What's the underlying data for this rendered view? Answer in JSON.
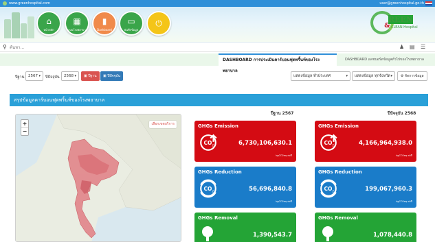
{
  "topbar": {
    "site": "www.greenhospital.com",
    "user": "user@greenhospital.go.th"
  },
  "nav": [
    {
      "icon": "home-icon",
      "glyph": "⌂",
      "label": "หน้าหลัก",
      "color": "#3aa54a"
    },
    {
      "icon": "hospital-icon",
      "glyph": "▦",
      "label": "ระบบโรงพยาบาล",
      "color": "#3aa54a"
    },
    {
      "icon": "chart-icon",
      "glyph": "▮",
      "label": "Dashboard",
      "color": "#f08a4b"
    },
    {
      "icon": "folder-icon",
      "glyph": "▭",
      "label": "บันทึกข้อมูล",
      "color": "#3aa54a"
    },
    {
      "icon": "power-icon",
      "glyph": "⏻",
      "label": "",
      "color": "#f4c518"
    }
  ],
  "logo": {
    "line1": "REEN",
    "amp": "&",
    "line2": "CLEAN Hospital"
  },
  "search": {
    "placeholder": "ค้นหา..."
  },
  "tabs": {
    "active": "DASHBOARD การประเมินคาร์บอนฟุตพริ้นท์ของโรงพยาบาล",
    "other": "DASHBOARD แดชบอร์ดข้อมูลทั่วไปของโรงพยาบาล"
  },
  "filters": {
    "base_label": "ปีฐาน",
    "base_value": "2567",
    "current_label": "ปีปัจจุบัน",
    "current_value": "2568",
    "base_btn": "ปีฐาน",
    "current_btn": "ปีปัจจุบัน",
    "scope_select": "แสดงข้อมูล ทั่วประเทศ",
    "type_select": "แสดงข้อมูล ทุกจังหวัด",
    "settings_btn": "จัดการข้อมูล"
  },
  "section": {
    "title": "สรุปข้อมูลคาร์บอนฟุตพริ้นท์ของโรงพยาบาล"
  },
  "map": {
    "link": "เลือกเขตบริการ"
  },
  "columns": {
    "base": "ปีฐาน 2567",
    "current": "ปีปัจจุบัน 2568"
  },
  "cards": {
    "base": [
      {
        "title": "GHGs Emission",
        "value": "6,730,106,630.1",
        "unit": "kgCO2eq ต่อปี",
        "kind": "emission"
      },
      {
        "title": "GHGs Reduction",
        "value": "56,696,840.8",
        "unit": "kgCO2eq ต่อปี",
        "kind": "reduction"
      },
      {
        "title": "GHGs Removal",
        "value": "1,390,543.7",
        "unit": "",
        "kind": "removal"
      }
    ],
    "current": [
      {
        "title": "GHGs Emission",
        "value": "4,166,964,938.0",
        "unit": "kgCO2eq ต่อปี",
        "kind": "emission"
      },
      {
        "title": "GHGs Reduction",
        "value": "199,067,960.3",
        "unit": "kgCO2eq ต่อปี",
        "kind": "reduction"
      },
      {
        "title": "GHGs Removal",
        "value": "1,078,440.8",
        "unit": "",
        "kind": "removal"
      }
    ]
  },
  "colors": {
    "emission": "#d40b13",
    "reduction": "#1a7cc9",
    "removal": "#24a436",
    "accent": "#2aa0d8"
  }
}
